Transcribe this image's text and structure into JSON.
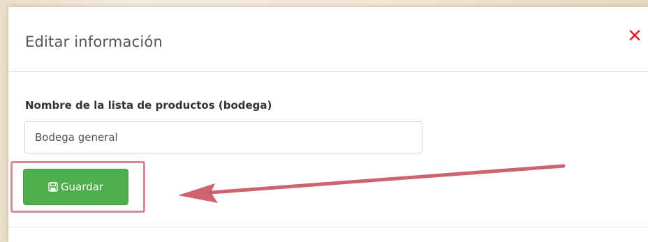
{
  "modal": {
    "title": "Editar información",
    "close_icon": "close-icon",
    "close_glyph": "✕"
  },
  "form": {
    "label": "Nombre de la lista de productos (bodega)",
    "input_value": "Bodega general"
  },
  "actions": {
    "save_label": "Guardar",
    "save_icon": "floppy-disk-icon"
  },
  "annotation": {
    "highlight_color": "#d98a94",
    "arrow_color": "#c9525e"
  },
  "colors": {
    "close": "#d8252b",
    "save_button": "#4cae4c"
  }
}
